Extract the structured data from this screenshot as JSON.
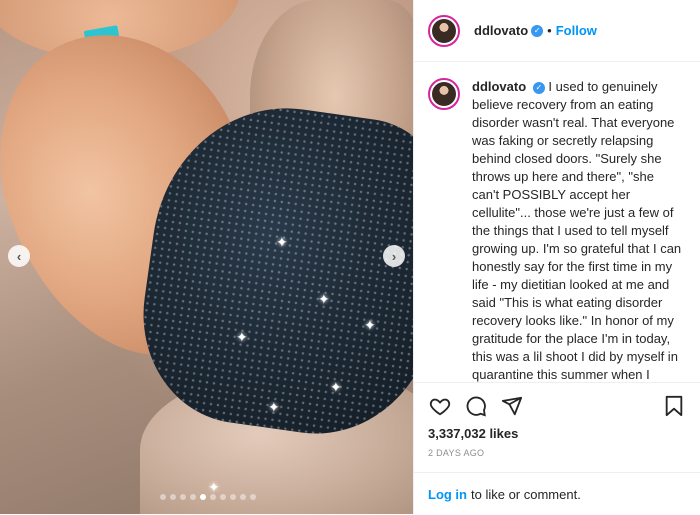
{
  "post": {
    "username": "ddlovato",
    "follow_label": "Follow",
    "separator": "•",
    "verified_glyph": "✓",
    "caption": "I used to genuinely believe recovery from an eating disorder wasn't real. That everyone was faking or secretly relapsing behind closed doors. \"Surely she throws up here and there\", \"she can't POSSIBLY accept her cellulite\"... those we're just a few of the things that I used to tell myself growing up. I'm so grateful that I can honestly say for the first time in my life - my dietitian looked at me and said \"This is what eating disorder recovery looks like.\" In honor of my gratitude for the place I'm in today, this was a lil shoot I did by myself in quarantine this summer when I wanted to celebrate my stretch marks instead of being ashamed of them. I hate how ashamed I used to be of my body",
    "likes": "3,337,032 likes",
    "time": "2 DAYS AGO",
    "login_link": "Log in",
    "login_rest": "to like or comment."
  },
  "carousel": {
    "prev_glyph": "‹",
    "next_glyph": "›",
    "dot_count": 10,
    "active_index": 4
  },
  "icons": {
    "like": "heart-icon",
    "comment": "comment-icon",
    "share": "share-icon",
    "save": "bookmark-icon"
  }
}
